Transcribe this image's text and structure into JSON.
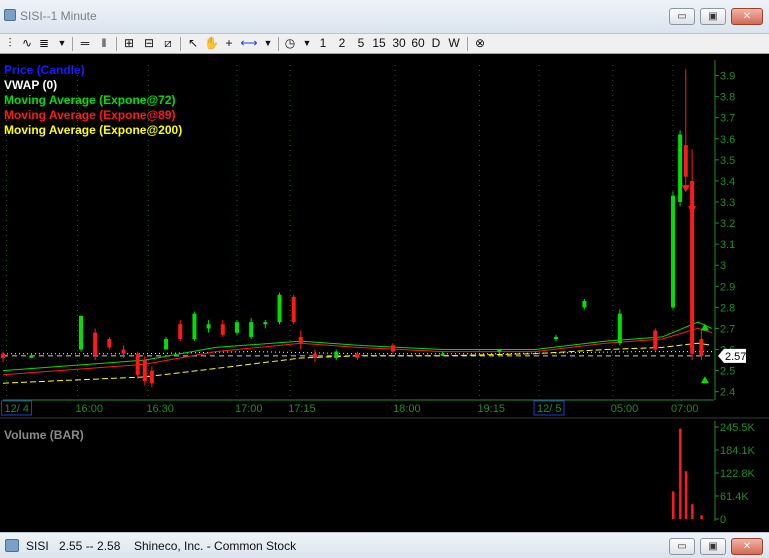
{
  "window": {
    "title": "SISI--1 Minute",
    "min_label": "▭",
    "restore_label": "▣",
    "close_label": "✕"
  },
  "toolbar": {
    "periods": [
      "1",
      "2",
      "5",
      "15",
      "30",
      "60",
      "D",
      "W"
    ]
  },
  "status": {
    "symbol": "SISI",
    "range": "2.55 -- 2.58",
    "company": "Shineco, Inc. - Common Stock"
  },
  "colors": {
    "price": "#1a1aff",
    "vwap": "#ffffff",
    "ema72": "#00e000",
    "ema89": "#ff1a1a",
    "ema200": "#ffff00",
    "axis": "#1f8f1f",
    "grid": "#1f5f1f"
  },
  "chart_data": [
    {
      "type": "candlestick",
      "title": "",
      "legend": [
        "Price (Candle)",
        "VWAP (0)",
        "Moving Average (Expone@72)",
        "Moving Average (Expone@89)",
        "Moving Average (Expone@200)"
      ],
      "legend_placement": "top-left",
      "ylim": [
        2.37,
        3.95
      ],
      "y_ticks": [
        "3.9",
        "3.8",
        "3.7",
        "3.6",
        "3.5",
        "3.4",
        "3.3",
        "3.2",
        "3.1",
        "3",
        "2.9",
        "2.8",
        "2.7",
        "2.6",
        "2.5",
        "2.4"
      ],
      "x_ticks": [
        "12/ 4",
        "16:00",
        "16:30",
        "17:00",
        "17:15",
        "18:00",
        "19:15",
        "12/ 5",
        "05:00",
        "07:00"
      ],
      "last_price": "2.57",
      "grid": true,
      "series": [
        {
          "name": "Price (Candle)",
          "candles": [
            {
              "t": 0.0,
              "o": 2.58,
              "h": 2.59,
              "l": 2.54,
              "c": 2.56
            },
            {
              "t": 0.04,
              "o": 2.57,
              "h": 2.58,
              "l": 2.56,
              "c": 2.57
            },
            {
              "t": 0.11,
              "o": 2.6,
              "h": 2.76,
              "l": 2.59,
              "c": 2.76
            },
            {
              "t": 0.13,
              "o": 2.68,
              "h": 2.7,
              "l": 2.55,
              "c": 2.57
            },
            {
              "t": 0.15,
              "o": 2.65,
              "h": 2.66,
              "l": 2.6,
              "c": 2.61
            },
            {
              "t": 0.17,
              "o": 2.6,
              "h": 2.62,
              "l": 2.56,
              "c": 2.58
            },
            {
              "t": 0.19,
              "o": 2.58,
              "h": 2.59,
              "l": 2.46,
              "c": 2.48
            },
            {
              "t": 0.2,
              "o": 2.55,
              "h": 2.57,
              "l": 2.43,
              "c": 2.45
            },
            {
              "t": 0.21,
              "o": 2.5,
              "h": 2.52,
              "l": 2.42,
              "c": 2.44
            },
            {
              "t": 0.23,
              "o": 2.6,
              "h": 2.66,
              "l": 2.6,
              "c": 2.65
            },
            {
              "t": 0.25,
              "o": 2.72,
              "h": 2.74,
              "l": 2.64,
              "c": 2.65
            },
            {
              "t": 0.27,
              "o": 2.65,
              "h": 2.78,
              "l": 2.64,
              "c": 2.77
            },
            {
              "t": 0.29,
              "o": 2.7,
              "h": 2.74,
              "l": 2.68,
              "c": 2.72
            },
            {
              "t": 0.31,
              "o": 2.72,
              "h": 2.74,
              "l": 2.66,
              "c": 2.67
            },
            {
              "t": 0.33,
              "o": 2.68,
              "h": 2.74,
              "l": 2.67,
              "c": 2.73
            },
            {
              "t": 0.35,
              "o": 2.66,
              "h": 2.75,
              "l": 2.65,
              "c": 2.73
            },
            {
              "t": 0.37,
              "o": 2.72,
              "h": 2.74,
              "l": 2.7,
              "c": 2.73
            },
            {
              "t": 0.39,
              "o": 2.73,
              "h": 2.87,
              "l": 2.72,
              "c": 2.86
            },
            {
              "t": 0.41,
              "o": 2.85,
              "h": 2.86,
              "l": 2.72,
              "c": 2.73
            },
            {
              "t": 0.42,
              "o": 2.66,
              "h": 2.69,
              "l": 2.6,
              "c": 2.63
            },
            {
              "t": 0.44,
              "o": 2.58,
              "h": 2.6,
              "l": 2.54,
              "c": 2.56
            },
            {
              "t": 0.47,
              "o": 2.56,
              "h": 2.6,
              "l": 2.55,
              "c": 2.59
            },
            {
              "t": 0.5,
              "o": 2.58,
              "h": 2.59,
              "l": 2.55,
              "c": 2.56
            },
            {
              "t": 0.55,
              "o": 2.62,
              "h": 2.63,
              "l": 2.58,
              "c": 2.59
            },
            {
              "t": 0.62,
              "o": 2.58,
              "h": 2.59,
              "l": 2.57,
              "c": 2.58
            },
            {
              "t": 0.7,
              "o": 2.59,
              "h": 2.6,
              "l": 2.58,
              "c": 2.6
            },
            {
              "t": 0.78,
              "o": 2.65,
              "h": 2.67,
              "l": 2.64,
              "c": 2.66
            },
            {
              "t": 0.82,
              "o": 2.8,
              "h": 2.84,
              "l": 2.79,
              "c": 2.83
            },
            {
              "t": 0.87,
              "o": 2.63,
              "h": 2.79,
              "l": 2.62,
              "c": 2.77
            },
            {
              "t": 0.92,
              "o": 2.69,
              "h": 2.7,
              "l": 2.59,
              "c": 2.6
            },
            {
              "t": 0.945,
              "o": 2.8,
              "h": 3.35,
              "l": 2.79,
              "c": 3.33
            },
            {
              "t": 0.955,
              "o": 3.3,
              "h": 3.64,
              "l": 3.28,
              "c": 3.62
            },
            {
              "t": 0.963,
              "o": 3.57,
              "h": 3.93,
              "l": 3.38,
              "c": 3.42
            },
            {
              "t": 0.972,
              "o": 3.4,
              "h": 3.55,
              "l": 2.55,
              "c": 2.58
            },
            {
              "t": 0.985,
              "o": 2.65,
              "h": 2.7,
              "l": 2.55,
              "c": 2.57
            }
          ]
        },
        {
          "name": "VWAP (0)",
          "x": [
            0.0,
            0.2,
            0.35,
            0.5,
            0.7,
            0.9,
            1.0
          ],
          "y": [
            2.58,
            2.58,
            2.59,
            2.58,
            2.58,
            2.59,
            2.59
          ]
        },
        {
          "name": "Moving Average (Expone@72)",
          "x": [
            0.0,
            0.2,
            0.3,
            0.42,
            0.5,
            0.62,
            0.75,
            0.85,
            0.93,
            0.98,
            1.0
          ],
          "y": [
            2.5,
            2.55,
            2.61,
            2.64,
            2.62,
            2.6,
            2.6,
            2.64,
            2.66,
            2.73,
            2.7
          ]
        },
        {
          "name": "Moving Average (Expone@89)",
          "x": [
            0.0,
            0.2,
            0.3,
            0.42,
            0.5,
            0.62,
            0.75,
            0.85,
            0.93,
            0.98,
            1.0
          ],
          "y": [
            2.48,
            2.53,
            2.59,
            2.63,
            2.61,
            2.59,
            2.59,
            2.63,
            2.65,
            2.7,
            2.68
          ]
        },
        {
          "name": "Moving Average (Expone@200)",
          "x": [
            0.0,
            0.2,
            0.3,
            0.42,
            0.5,
            0.62,
            0.75,
            0.85,
            0.93,
            0.98,
            1.0
          ],
          "y": [
            2.44,
            2.47,
            2.51,
            2.56,
            2.57,
            2.57,
            2.58,
            2.6,
            2.61,
            2.63,
            2.62
          ]
        }
      ]
    },
    {
      "type": "bar",
      "title": "Volume (BAR)",
      "ylim": [
        0,
        250000
      ],
      "y_ticks": [
        "245.5K",
        "184.1K",
        "122.8K",
        "61.4K",
        "0"
      ],
      "series": [
        {
          "name": "Volume (BAR)",
          "x": [
            0.945,
            0.955,
            0.963,
            0.972,
            0.985
          ],
          "values": [
            75000,
            245500,
            130000,
            40000,
            10000
          ]
        }
      ]
    }
  ]
}
